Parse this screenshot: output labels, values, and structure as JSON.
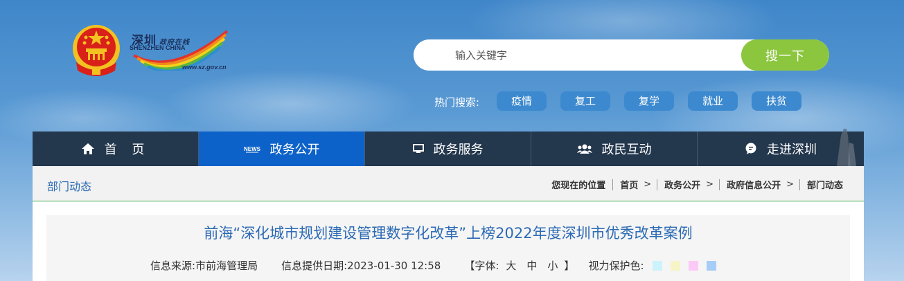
{
  "header": {
    "logo": {
      "name_cn": "深圳",
      "tagline_cn": "政府在线",
      "name_en": "SHENZHEN  CHINA",
      "url": "www.sz.gov.cn",
      "emblem_icon": "national-emblem-icon"
    },
    "search": {
      "placeholder": "输入关键字",
      "value": "",
      "button_label": "搜一下"
    },
    "hot_search": {
      "label": "热门搜索:",
      "tags": [
        "疫情",
        "复工",
        "复学",
        "就业",
        "扶贫"
      ]
    }
  },
  "nav": {
    "items": [
      {
        "label": "首 页",
        "icon": "home-icon",
        "active": false
      },
      {
        "label": "政务公开",
        "icon": "news-icon",
        "active": true
      },
      {
        "label": "政务服务",
        "icon": "monitor-icon",
        "active": false
      },
      {
        "label": "政民互动",
        "icon": "users-icon",
        "active": false
      },
      {
        "label": "走进深圳",
        "icon": "chat-bubble-icon",
        "active": false
      }
    ]
  },
  "breadcrumb": {
    "section_title": "部门动态",
    "label": "您现在的位置",
    "items": [
      "首页",
      "政务公开",
      "政府信息公开",
      "部门动态"
    ],
    "separator": ">"
  },
  "article": {
    "title": "前海“深化城市规划建设管理数字化改革”上榜2022年度深圳市优秀改革案例",
    "source_label": "信息来源:",
    "source_value": "市前海管理局",
    "date_label": "信息提供日期:",
    "date_value": "2023-01-30 12:58",
    "font_label_open": "【字体:",
    "font_sizes": [
      "大",
      "中",
      "小"
    ],
    "font_label_close": "】",
    "eye_care_label": "视力保护色:",
    "eye_care_colors": [
      "#ccf2fb",
      "#f7f4c7",
      "#fbc9f6",
      "#a6cdf8"
    ]
  },
  "colors": {
    "nav_bg": "#23374d",
    "nav_active": "#0d62c9",
    "search_button": "#8cc63f",
    "hot_tag": "#3c89cf",
    "title_blue": "#2c6ab4",
    "divider_green": "#3daa4a"
  }
}
